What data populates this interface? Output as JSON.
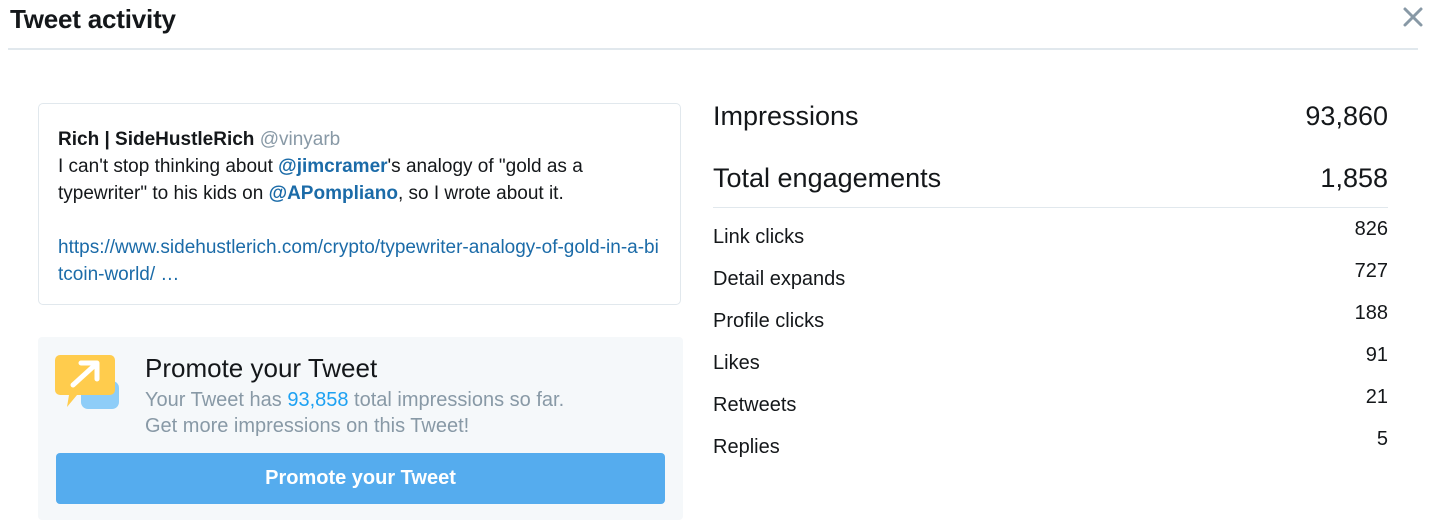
{
  "header": {
    "title": "Tweet activity"
  },
  "tweet": {
    "author_name": "Rich | SideHustleRich",
    "author_handle": "@vinyarb",
    "text_1": "I can't stop thinking about ",
    "mention_1": "@jimcramer",
    "text_2": "'s  analogy of \"gold as a typewriter\" to his kids on ",
    "mention_2": "@APompliano",
    "text_3": ", so I wrote about it.",
    "link": "https://www.sidehustlerich.com/crypto/typewriter-analogy-of-gold-in-a-bitcoin-world/ …"
  },
  "promo": {
    "title": "Promote your Tweet",
    "text_before": "Your Tweet has ",
    "impressions": "93,858",
    "text_after": " total impressions so far.",
    "line2": "Get more impressions on this Tweet!",
    "button_label": "Promote your Tweet"
  },
  "stats": {
    "impressions": {
      "label": "Impressions",
      "value": "93,860"
    },
    "engagements": {
      "label": "Total engagements",
      "value": "1,858"
    },
    "rows": [
      {
        "label": "Link clicks",
        "value": "826"
      },
      {
        "label": "Detail expands",
        "value": "727"
      },
      {
        "label": "Profile clicks",
        "value": "188"
      },
      {
        "label": "Likes",
        "value": "91"
      },
      {
        "label": "Retweets",
        "value": "21"
      },
      {
        "label": "Replies",
        "value": "5"
      }
    ]
  },
  "colors": {
    "link": "#1b6ba8",
    "button": "#55acee",
    "promo_bg": "#f5f8fa",
    "icon_yellow": "#ffcc4d",
    "icon_blue": "#8ecdf8"
  }
}
